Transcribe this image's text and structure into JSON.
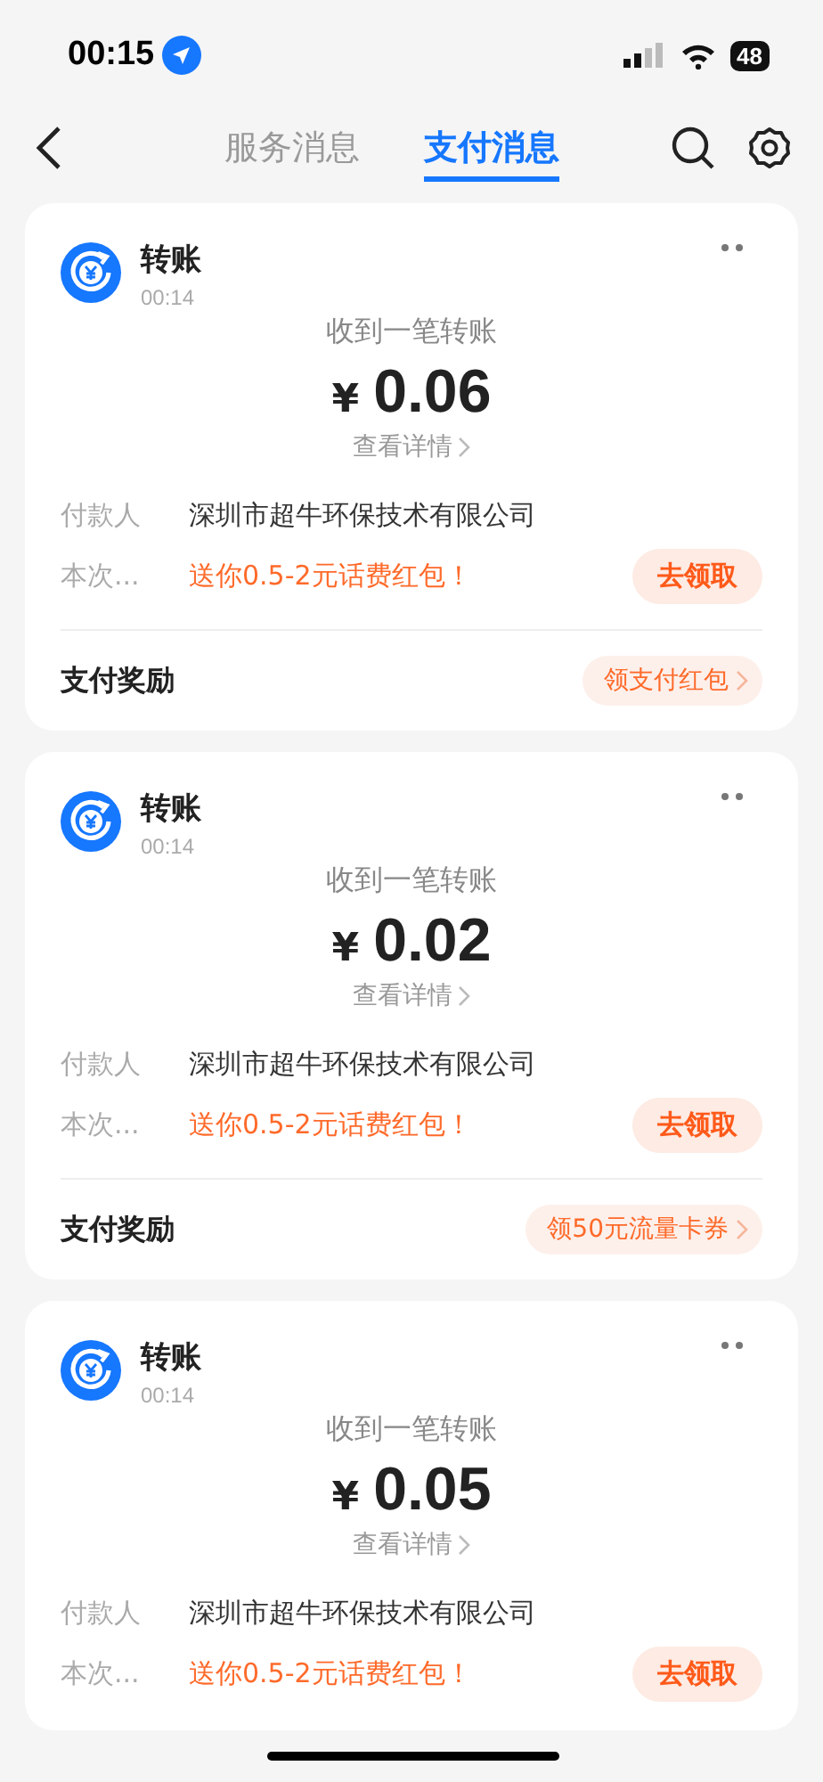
{
  "status_bar": {
    "time": "00:15",
    "battery": "48"
  },
  "nav": {
    "tabs": [
      {
        "label": "服务消息",
        "selected": false
      },
      {
        "label": "支付消息",
        "selected": true
      }
    ]
  },
  "cards": [
    {
      "title": "转账",
      "time": "00:14",
      "heading": "收到一笔转账",
      "currency": "¥",
      "amount": "0.06",
      "details_link": "查看详情",
      "fields": [
        {
          "kind": "text",
          "label": "付款人",
          "value": "深圳市超牛环保技术有限公司"
        },
        {
          "kind": "promo",
          "label": "本次...",
          "value": "送你0.5-2元话费红包！",
          "action": "去领取"
        }
      ],
      "reward": {
        "label": "支付奖励",
        "action": "领支付红包"
      }
    },
    {
      "title": "转账",
      "time": "00:14",
      "heading": "收到一笔转账",
      "currency": "¥",
      "amount": "0.02",
      "details_link": "查看详情",
      "fields": [
        {
          "kind": "text",
          "label": "付款人",
          "value": "深圳市超牛环保技术有限公司"
        },
        {
          "kind": "promo",
          "label": "本次...",
          "value": "送你0.5-2元话费红包！",
          "action": "去领取"
        }
      ],
      "reward": {
        "label": "支付奖励",
        "action": "领50元流量卡券"
      }
    },
    {
      "title": "转账",
      "time": "00:14",
      "heading": "收到一笔转账",
      "currency": "¥",
      "amount": "0.05",
      "details_link": "查看详情",
      "fields": [
        {
          "kind": "text",
          "label": "付款人",
          "value": "深圳市超牛环保技术有限公司"
        },
        {
          "kind": "promo",
          "label": "本次...",
          "value": "送你0.5-2元话费红包！",
          "action": "去领取"
        }
      ]
    }
  ]
}
